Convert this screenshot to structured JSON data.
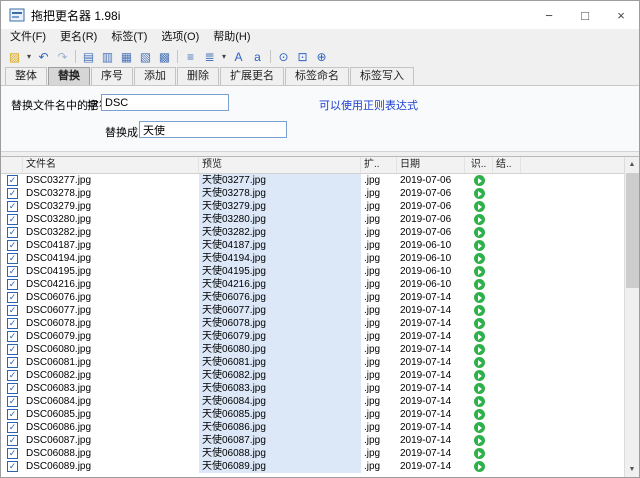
{
  "window": {
    "title": "拖把更名器 1.98i",
    "controls": {
      "minimize": "−",
      "maximize": "□",
      "close": "×"
    }
  },
  "menu": [
    "文件(F)",
    "更名(R)",
    "标签(T)",
    "选项(O)",
    "帮助(H)"
  ],
  "toolbar": [
    {
      "name": "open-folder-icon",
      "glyph": "▨",
      "color": "#d9a50f"
    },
    {
      "name": "open-folder-dropdown-icon",
      "glyph": "▾",
      "color": "#444",
      "dd": true
    },
    {
      "name": "undo-icon",
      "glyph": "↶",
      "color": "#2f62c4"
    },
    {
      "name": "redo-icon",
      "glyph": "↷",
      "color": "#9fb0d0"
    },
    {
      "name": "toolbar-separator",
      "glyph": "",
      "sep": true
    },
    {
      "name": "whole-rename-icon",
      "glyph": "▤",
      "color": "#4a74b8"
    },
    {
      "name": "replace-icon",
      "glyph": "▥",
      "color": "#4a74b8"
    },
    {
      "name": "sequence-icon",
      "glyph": "▦",
      "color": "#4a74b8"
    },
    {
      "name": "insert-icon",
      "glyph": "▧",
      "color": "#4a74b8"
    },
    {
      "name": "delete-icon",
      "glyph": "▩",
      "color": "#4a74b8"
    },
    {
      "name": "toolbar-separator",
      "glyph": "",
      "sep": true
    },
    {
      "name": "list-icon",
      "glyph": "≡",
      "color": "#4a74b8"
    },
    {
      "name": "tag-list-icon",
      "glyph": "≣",
      "color": "#4a74b8"
    },
    {
      "name": "case-dropdown-icon",
      "glyph": "▾",
      "color": "#444",
      "dd": true
    },
    {
      "name": "uppercase-icon",
      "glyph": "A",
      "color": "#2f62c4"
    },
    {
      "name": "lowercase-icon",
      "glyph": "a",
      "color": "#2f62c4"
    },
    {
      "name": "toolbar-separator",
      "glyph": "",
      "sep": true
    },
    {
      "name": "clock-icon",
      "glyph": "⊙",
      "color": "#2f62c4"
    },
    {
      "name": "lock-icon",
      "glyph": "⊡",
      "color": "#2f62c4"
    },
    {
      "name": "search-icon",
      "glyph": "⊕",
      "color": "#2f62c4"
    }
  ],
  "tabs": [
    {
      "name": "tab-whole",
      "label": "整体"
    },
    {
      "name": "tab-replace",
      "label": "替换",
      "active": true
    },
    {
      "name": "tab-sequence",
      "label": "序号"
    },
    {
      "name": "tab-add",
      "label": "添加"
    },
    {
      "name": "tab-delete",
      "label": "删除"
    },
    {
      "name": "tab-ext-rename",
      "label": "扩展更名"
    },
    {
      "name": "tab-tag-name",
      "label": "标签命名"
    },
    {
      "name": "tab-tag-write",
      "label": "标签写入"
    }
  ],
  "form": {
    "label_main": "替换文件名中的字符:",
    "label_ba": "把",
    "find_value": "DSC",
    "hint": "可以使用正则表达式",
    "label_to": "替换成",
    "replace_value": "天使"
  },
  "table": {
    "headers": [
      "文件名",
      "预览",
      "扩..",
      "日期",
      "识..",
      "结.."
    ],
    "rows": [
      {
        "filename": "DSC03277.jpg",
        "preview": "天使03277.jpg",
        "ext": ".jpg",
        "date": "2019-07-06"
      },
      {
        "filename": "DSC03278.jpg",
        "preview": "天使03278.jpg",
        "ext": ".jpg",
        "date": "2019-07-06"
      },
      {
        "filename": "DSC03279.jpg",
        "preview": "天使03279.jpg",
        "ext": ".jpg",
        "date": "2019-07-06"
      },
      {
        "filename": "DSC03280.jpg",
        "preview": "天使03280.jpg",
        "ext": ".jpg",
        "date": "2019-07-06"
      },
      {
        "filename": "DSC03282.jpg",
        "preview": "天使03282.jpg",
        "ext": ".jpg",
        "date": "2019-07-06"
      },
      {
        "filename": "DSC04187.jpg",
        "preview": "天使04187.jpg",
        "ext": ".jpg",
        "date": "2019-06-10"
      },
      {
        "filename": "DSC04194.jpg",
        "preview": "天使04194.jpg",
        "ext": ".jpg",
        "date": "2019-06-10"
      },
      {
        "filename": "DSC04195.jpg",
        "preview": "天使04195.jpg",
        "ext": ".jpg",
        "date": "2019-06-10"
      },
      {
        "filename": "DSC04216.jpg",
        "preview": "天使04216.jpg",
        "ext": ".jpg",
        "date": "2019-06-10"
      },
      {
        "filename": "DSC06076.jpg",
        "preview": "天使06076.jpg",
        "ext": ".jpg",
        "date": "2019-07-14"
      },
      {
        "filename": "DSC06077.jpg",
        "preview": "天使06077.jpg",
        "ext": ".jpg",
        "date": "2019-07-14"
      },
      {
        "filename": "DSC06078.jpg",
        "preview": "天使06078.jpg",
        "ext": ".jpg",
        "date": "2019-07-14"
      },
      {
        "filename": "DSC06079.jpg",
        "preview": "天使06079.jpg",
        "ext": ".jpg",
        "date": "2019-07-14"
      },
      {
        "filename": "DSC06080.jpg",
        "preview": "天使06080.jpg",
        "ext": ".jpg",
        "date": "2019-07-14"
      },
      {
        "filename": "DSC06081.jpg",
        "preview": "天使06081.jpg",
        "ext": ".jpg",
        "date": "2019-07-14"
      },
      {
        "filename": "DSC06082.jpg",
        "preview": "天使06082.jpg",
        "ext": ".jpg",
        "date": "2019-07-14"
      },
      {
        "filename": "DSC06083.jpg",
        "preview": "天使06083.jpg",
        "ext": ".jpg",
        "date": "2019-07-14"
      },
      {
        "filename": "DSC06084.jpg",
        "preview": "天使06084.jpg",
        "ext": ".jpg",
        "date": "2019-07-14"
      },
      {
        "filename": "DSC06085.jpg",
        "preview": "天使06085.jpg",
        "ext": ".jpg",
        "date": "2019-07-14"
      },
      {
        "filename": "DSC06086.jpg",
        "preview": "天使06086.jpg",
        "ext": ".jpg",
        "date": "2019-07-14"
      },
      {
        "filename": "DSC06087.jpg",
        "preview": "天使06087.jpg",
        "ext": ".jpg",
        "date": "2019-07-14"
      },
      {
        "filename": "DSC06088.jpg",
        "preview": "天使06088.jpg",
        "ext": ".jpg",
        "date": "2019-07-14"
      },
      {
        "filename": "DSC06089.jpg",
        "preview": "天使06089.jpg",
        "ext": ".jpg",
        "date": "2019-07-14"
      }
    ]
  },
  "scrollbar": {
    "up": "▲",
    "down": "▼"
  },
  "colors": {
    "preview_cell_bg": "#dce8f8",
    "status_green": "#2eb04a",
    "link_blue": "#1b3fd0",
    "checkbox_blue": "#2a62b8",
    "input_border": "#7aa0cf"
  }
}
